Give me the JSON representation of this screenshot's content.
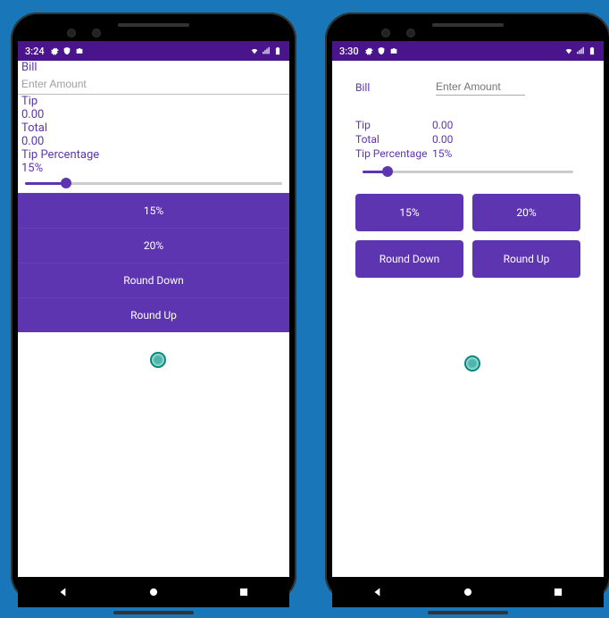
{
  "left": {
    "status_time": "3:24",
    "bill_label": "Bill",
    "amount_placeholder": "Enter Amount",
    "tip_label": "Tip",
    "tip_value": "0.00",
    "total_label": "Total",
    "total_value": "0.00",
    "tip_pct_label": "Tip Percentage",
    "tip_pct_value": "15%",
    "buttons": {
      "pct15": "15%",
      "pct20": "20%",
      "round_down": "Round Down",
      "round_up": "Round Up"
    }
  },
  "right": {
    "status_time": "3:30",
    "bill_label": "Bill",
    "amount_placeholder": "Enter Amount",
    "tip_label": "Tip",
    "tip_value": "0.00",
    "total_label": "Total",
    "total_value": "0.00",
    "tip_pct_label": "Tip Percentage",
    "tip_pct_value": "15%",
    "buttons": {
      "pct15": "15%",
      "pct20": "20%",
      "round_down": "Round Down",
      "round_up": "Round Up"
    }
  }
}
